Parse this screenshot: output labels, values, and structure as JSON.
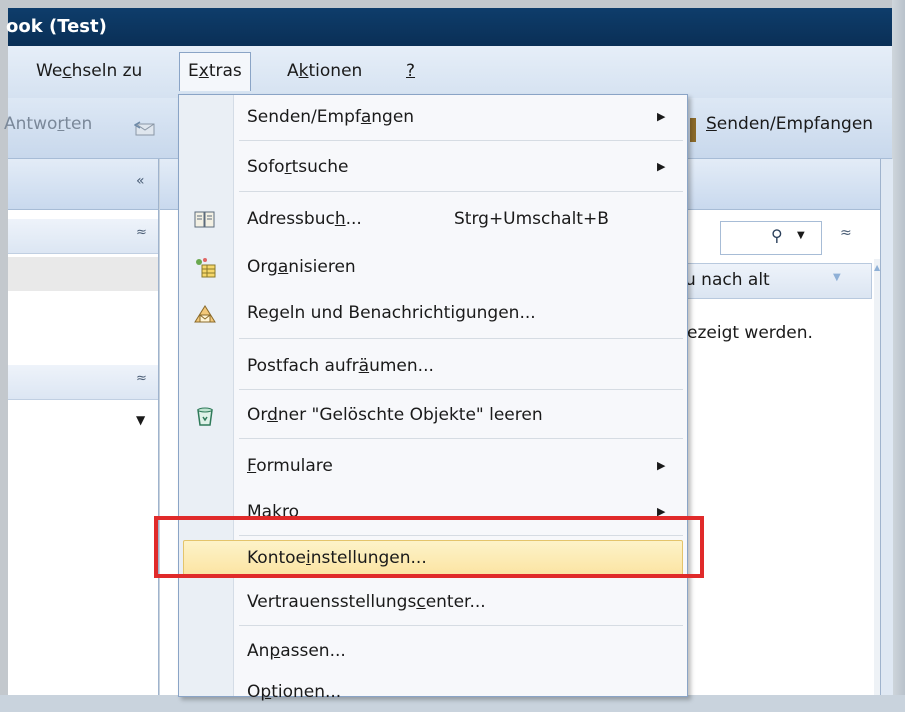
{
  "window": {
    "title": "ook (Test)"
  },
  "menubar": {
    "items": [
      {
        "pre": "We",
        "ul": "c",
        "post": "hseln zu"
      },
      {
        "pre": "E",
        "ul": "x",
        "post": "tras"
      },
      {
        "pre": "A",
        "ul": "k",
        "post": "tionen"
      },
      {
        "pre": "",
        "ul": "?",
        "post": ""
      }
    ]
  },
  "toolbar": {
    "reply": {
      "pre": "Antwo",
      "ul": "r",
      "post": "ten"
    },
    "send_receive": {
      "pre": "",
      "ul": "S",
      "post": "enden/Empfangen"
    }
  },
  "list": {
    "sort_label": "u nach alt",
    "empty_text": "ezeigt werden."
  },
  "extras_menu": {
    "items": [
      {
        "pre": "Senden/Empf",
        "ul": "a",
        "post": "ngen",
        "submenu": true
      },
      {
        "pre": "Sofo",
        "ul": "r",
        "post": "tsuche",
        "submenu": true
      },
      {
        "pre": "Adressbuc",
        "ul": "h",
        "post": "...",
        "shortcut": "Strg+Umschalt+B",
        "icon": "address-book-icon"
      },
      {
        "pre": "Org",
        "ul": "a",
        "post": "nisieren",
        "icon": "organize-icon"
      },
      {
        "pre": "Re",
        "ul": "g",
        "post": "eln und Benachrichtigungen...",
        "icon": "rules-icon"
      },
      {
        "pre": "Postfach aufr",
        "ul": "ä",
        "post": "umen..."
      },
      {
        "pre": "Or",
        "ul": "d",
        "post": "ner \"Gelöschte Objekte\" leeren",
        "icon": "empty-trash-icon"
      },
      {
        "pre": "",
        "ul": "F",
        "post": "ormulare",
        "submenu": true
      },
      {
        "pre": "Ma",
        "ul": "k",
        "post": "ro",
        "submenu": true
      },
      {
        "pre": "Kontoe",
        "ul": "i",
        "post": "nstellungen...",
        "highlighted": true
      },
      {
        "pre": "Vertrauensstellungs",
        "ul": "c",
        "post": "enter..."
      },
      {
        "pre": "An",
        "ul": "p",
        "post": "assen..."
      },
      {
        "pre": "O",
        "ul": "p",
        "post": "tionen..."
      }
    ]
  },
  "colors": {
    "titlebar": "#0e3d6b",
    "highlight": "#fbe3a0",
    "annotation": "#e02a2a"
  }
}
